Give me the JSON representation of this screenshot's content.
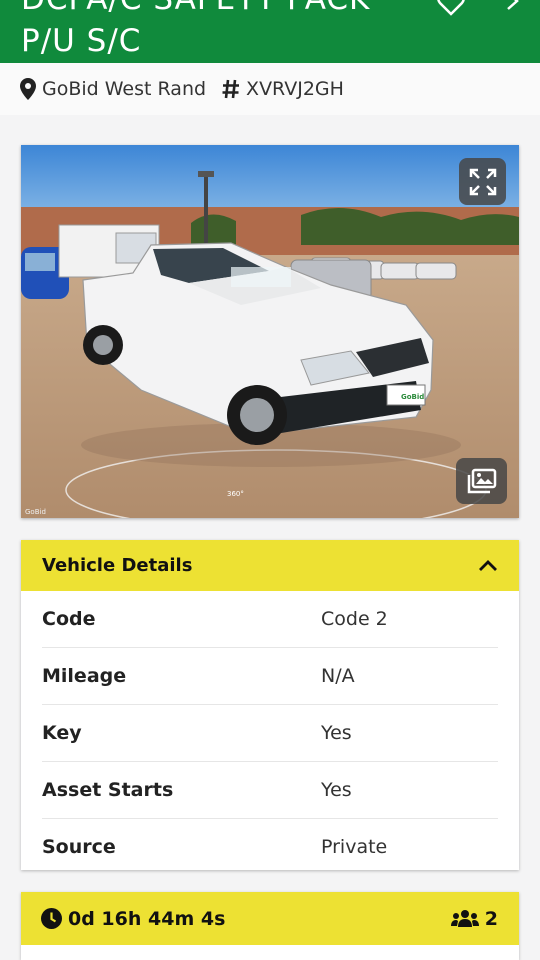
{
  "header": {
    "title": "DCPA/C SAFETY PACK P/U S/C",
    "icons": [
      "heart-icon",
      "share-icon"
    ]
  },
  "meta": {
    "location": "GoBid West Rand",
    "reference": "XVRVJ2GH",
    "location_icon": "map-pin-icon",
    "reference_icon": "hash-icon"
  },
  "photo": {
    "watermark": "GoBid",
    "badge_360": "360°",
    "fullscreen_icon": "expand-icon",
    "gallery_icon": "images-icon"
  },
  "vehicle_details": {
    "title": "Vehicle Details",
    "rows": [
      {
        "label": "Code",
        "value": "Code 2"
      },
      {
        "label": "Mileage",
        "value": "N/A"
      },
      {
        "label": "Key",
        "value": "Yes"
      },
      {
        "label": "Asset Starts",
        "value": "Yes"
      },
      {
        "label": "Source",
        "value": "Private"
      }
    ]
  },
  "auction": {
    "time_left": "0d 16h 44m 4s",
    "bidders": "2",
    "clock_icon": "clock-icon",
    "users_icon": "users-icon"
  },
  "colors": {
    "brand_green": "#108a3c",
    "accent_yellow": "#ede133"
  }
}
